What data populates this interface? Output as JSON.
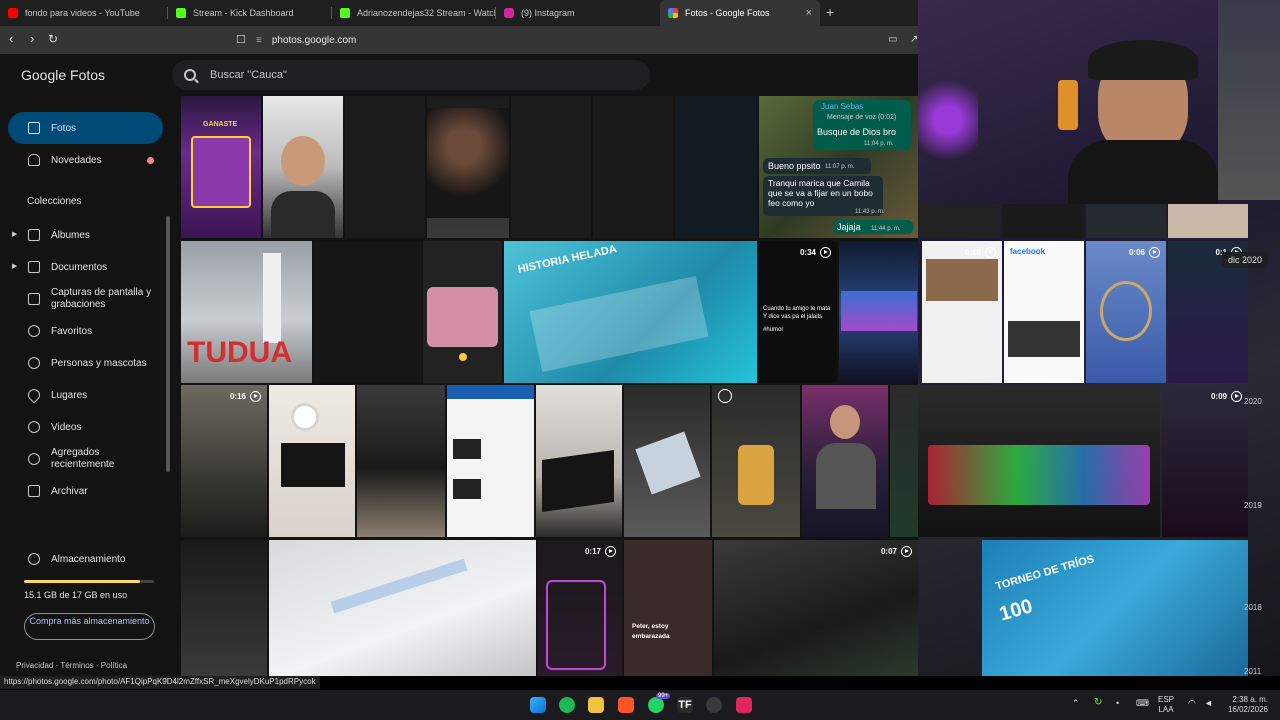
{
  "browser": {
    "tabs": [
      {
        "title": "fondo para videos - YouTube",
        "color": "#ff0000",
        "active": false
      },
      {
        "title": "Stream - Kick Dashboard",
        "color": "#53fc18",
        "active": false
      },
      {
        "title": "Adrianozendejas32 Stream - Watch l",
        "color": "#53fc18",
        "active": false
      },
      {
        "title": "(9) Instagram",
        "color": "#d6249f",
        "active": false
      },
      {
        "title": "Fotos - Google Fotos",
        "color": "#fbbc04",
        "active": true
      }
    ],
    "close_glyph": "×",
    "new_tab_glyph": "+",
    "url": "photos.google.com",
    "status_url": "https://photos.google.com/photo/AF1QipPqK9D4l2mZffxSR_meXgvelyDKuP1pdRPycok"
  },
  "app": {
    "logo_google": "Google",
    "logo_fotos": "Fotos",
    "search_text": "Buscar \"Cauca\""
  },
  "nav": {
    "items": [
      {
        "label": "Fotos",
        "icon": "photo-icon"
      },
      {
        "label": "Novedades",
        "icon": "bell-icon"
      }
    ],
    "collections_title": "Colecciones",
    "collections": [
      {
        "label": "Álbumes",
        "icon": "album-icon"
      },
      {
        "label": "Documentos",
        "icon": "document-icon"
      },
      {
        "label": "Capturas de pantalla y grabaciones",
        "icon": "screenshot-icon"
      },
      {
        "label": "Favoritos",
        "icon": "star-icon"
      },
      {
        "label": "Personas y mascotas",
        "icon": "face-icon"
      },
      {
        "label": "Lugares",
        "icon": "place-icon"
      },
      {
        "label": "Videos",
        "icon": "play-icon"
      },
      {
        "label": "Agregados recientemente",
        "icon": "recent-icon"
      },
      {
        "label": "Archivar",
        "icon": "archive-icon"
      }
    ],
    "storage_label": "Almacenamiento",
    "storage_used": "15.1 GB de 17 GB en uso",
    "storage_fraction": 0.89,
    "buy_label": "Compra más almacenamiento",
    "footer_links": [
      "Privacidad",
      "Términos",
      "Política"
    ]
  },
  "grid": {
    "durations": [
      "0:34",
      "0:10",
      "0:06",
      "0:1",
      "0:16",
      "0:09",
      "0:17",
      "0:07"
    ],
    "captions": {
      "chat_sender": "Juan Sebas",
      "chat_voice": "Mensaje de voz (0:02)",
      "chat_msg1": "Busque de Dios bro",
      "chat_time1": "11:04 p. m.",
      "chat_msg2": "Bueno ppsito",
      "chat_time2": "11:07 p. m.",
      "chat_msg3": "Tranqui marica que Camila que se va a fijar en un bobo feo como yo",
      "chat_time3": "11:43 p. m.",
      "chat_msg4": "Jajaja",
      "chat_time4": "11:44 p. m.",
      "game_title": "GANASTE",
      "meme1": "Cuando tu amigo te mata Y dice vas pa el jalaits",
      "meme1_tag": "#humor",
      "tudua": "TUDUA",
      "historia": "HISTORIA HELADA",
      "peter": "Peter, estoy embarazada",
      "torneo": "TORNEO DE TRÍOS",
      "score": "100",
      "facebook": "facebook"
    },
    "date_badge": "dic 2020",
    "year_labels": [
      "2020",
      "2019",
      "2018",
      "2011"
    ]
  },
  "taskbar": {
    "lang": "ESP",
    "region": "LAA",
    "time": "2:38 a. m.",
    "date": "16/02/2026",
    "badge": "99+"
  }
}
